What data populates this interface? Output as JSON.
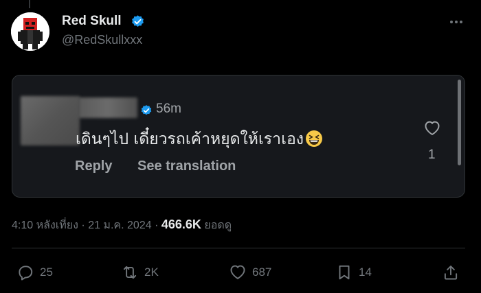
{
  "author": {
    "name": "Red Skull",
    "handle": "@RedSkullxxx"
  },
  "reply": {
    "time": "56m",
    "text": "เดินๆไป เดี๋ยวรถเค้าหยุดให้เราเอง",
    "reply_label": "Reply",
    "translate_label": "See translation",
    "like_count": "1"
  },
  "meta": {
    "time": "4:10 หลังเที่ยง",
    "date": "21 ม.ค. 2024",
    "views": "466.6K",
    "views_label": "ยอดดู"
  },
  "actions": {
    "replies": "25",
    "reposts": "2K",
    "likes": "687",
    "bookmarks": "14"
  },
  "colors": {
    "verified": "#1d9bf0",
    "text_muted": "#71767b",
    "background": "#000000"
  },
  "icons": [
    "verified-badge-icon",
    "more-icon",
    "heart-icon",
    "reply-icon",
    "repost-icon",
    "bookmark-icon",
    "share-icon",
    "grinning-squinting-face-emoji"
  ]
}
